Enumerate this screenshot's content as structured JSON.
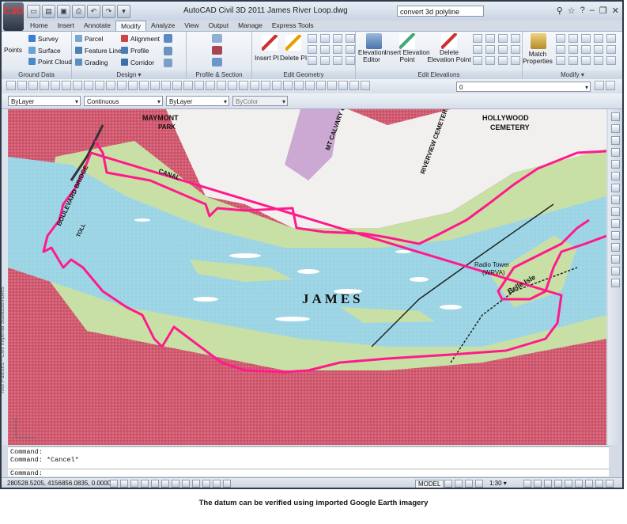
{
  "window": {
    "app_button": "C3D",
    "title": "AutoCAD Civil 3D 2011    James River Loop.dwg",
    "search_value": "convert 3d  polyline"
  },
  "ribbon_tabs": [
    "Home",
    "Insert",
    "Annotate",
    "Modify",
    "Analyze",
    "View",
    "Output",
    "Manage",
    "Express Tools"
  ],
  "ribbon": {
    "ground_data": {
      "title": "Ground Data",
      "points": "Points",
      "survey": "Survey",
      "surface": "Surface",
      "point_cloud": "Point Cloud"
    },
    "design": {
      "title": "Design ▾",
      "parcel": "Parcel",
      "feature_line": "Feature Line",
      "grading": "Grading",
      "alignment": "Alignment",
      "profile": "Profile",
      "corridor": "Corridor"
    },
    "profile_section": {
      "title": "Profile & Section Views"
    },
    "edit_geometry": {
      "title": "Edit Geometry",
      "insert_pi": "Insert PI",
      "delete_pi": "Delete PI"
    },
    "edit_elevations": {
      "title": "Edit Elevations",
      "elevation_editor": "Elevation Editor",
      "insert_elevation_point": "Insert Elevation Point",
      "delete_elevation_point": "Delete Elevation Point"
    },
    "modify": {
      "title": "Modify ▾",
      "match_properties": "Match Properties"
    }
  },
  "properties_bar": {
    "color": "ByLayer",
    "linetype": "Continuous",
    "lineweight": "ByLayer",
    "plotstyle": "ByColor",
    "layer": "0"
  },
  "map": {
    "labels": {
      "james": "JAMES",
      "belle_isle": "Belle Isle",
      "maymont": "MAYMONT",
      "park": "PARK",
      "hollywood": "HOLLYWOOD",
      "cemetery": "CEMETERY",
      "mt_calvary": "MT CALVARY CEMETERY",
      "riverview": "RIVERVIEW CEMETERY",
      "boulevard": "BOULEVARD BRIDGE",
      "toll": "TOLL",
      "canal": "CANAL",
      "radio_tower": "Radio Tower",
      "wrva": "(WRVA)"
    },
    "side_text": "Tool Palettes - Civil Imperial Subassemblies",
    "colors": {
      "river": "#9fd6e6",
      "urban": "#d0586e",
      "forest": "#c8e0a5",
      "route": "#ff1a8c"
    }
  },
  "command": {
    "line1": "Command:",
    "line2": "Command: *Cancel*",
    "prompt": "Command:"
  },
  "status": {
    "coords": "280528.5205, 4156856.0835, 0.0000",
    "model": "MODEL",
    "scale": "1:30 ▾"
  },
  "caption": "The datum can be verified using imported Google Earth imagery"
}
